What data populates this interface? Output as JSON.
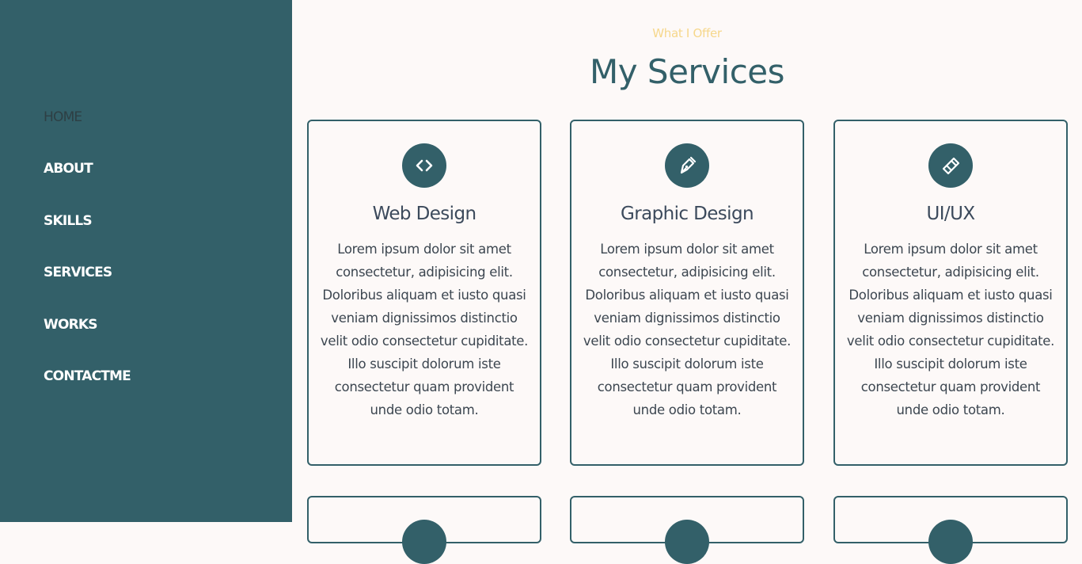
{
  "nav": {
    "items": [
      {
        "label": "HOME"
      },
      {
        "label": "ABOUT"
      },
      {
        "label": "SKILLS"
      },
      {
        "label": "SERVICES"
      },
      {
        "label": "WORKS"
      },
      {
        "label": "CONTACTME"
      }
    ],
    "active": "HOME"
  },
  "services": {
    "eyebrow": "What I Offer",
    "title": "My Services",
    "cards": [
      {
        "icon": "code-icon",
        "title": "Web Design",
        "text": "Lorem ipsum dolor sit amet consectetur, adipisicing elit. Doloribus aliquam et iusto quasi veniam dignissimos distinctio velit odio consectetur cupiditate. Illo suscipit dolorum iste consectetur quam provident unde odio totam."
      },
      {
        "icon": "pen-nib-icon",
        "title": "Graphic Design",
        "text": "Lorem ipsum dolor sit amet consectetur, adipisicing elit. Doloribus aliquam et iusto quasi veniam dignissimos distinctio velit odio consectetur cupiditate. Illo suscipit dolorum iste consectetur quam provident unde odio totam."
      },
      {
        "icon": "eraser-icon",
        "title": "UI/UX",
        "text": "Lorem ipsum dolor sit amet consectetur, adipisicing elit. Doloribus aliquam et iusto quasi veniam dignissimos distinctio velit odio consectetur cupiditate. Illo suscipit dolorum iste consectetur quam provident unde odio totam."
      }
    ]
  },
  "colors": {
    "sidebar": "#336069",
    "accent": "#f6d78b",
    "background": "#fdf9f8"
  }
}
